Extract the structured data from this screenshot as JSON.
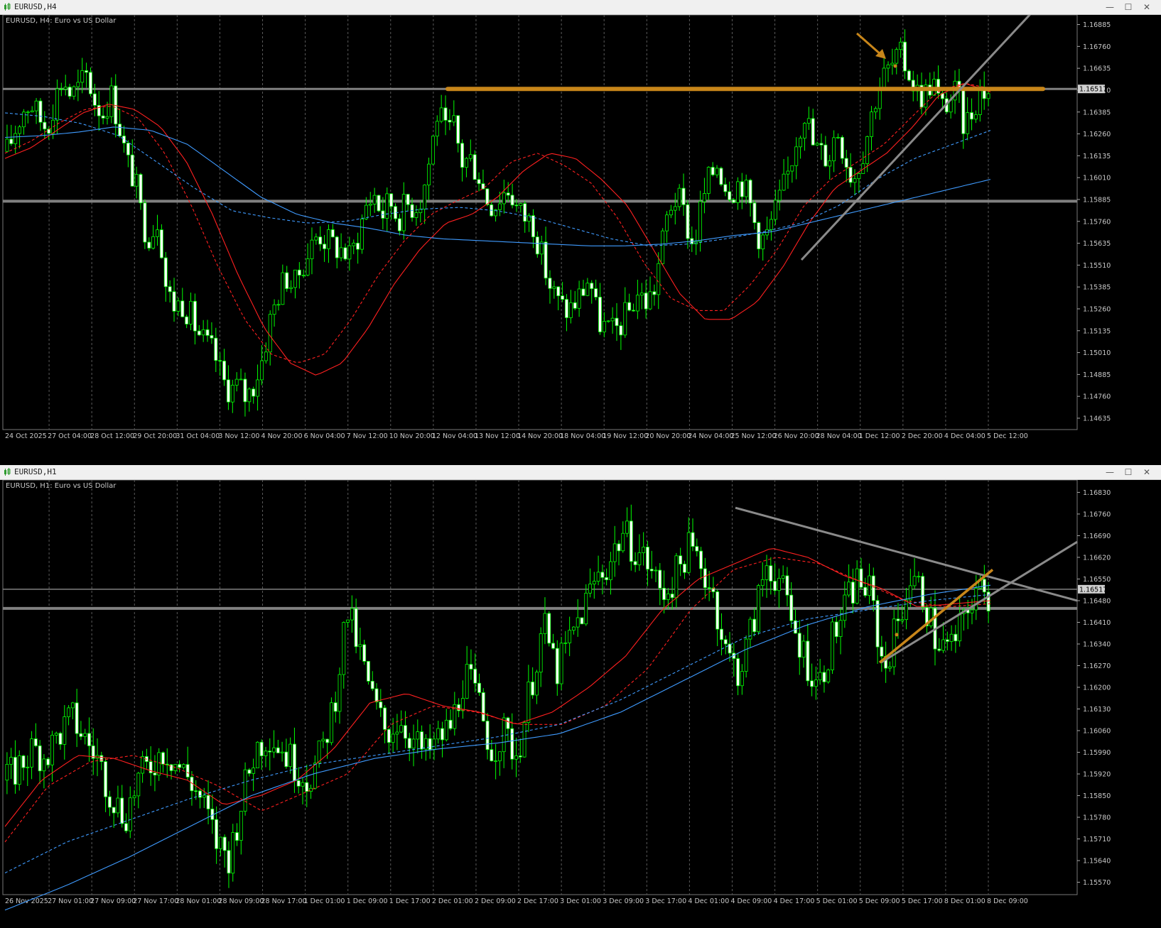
{
  "windows": [
    {
      "title": "EURUSD,H4",
      "label": "EURUSD, H4:  Euro vs US Dollar",
      "price_tag": "1.16517",
      "controls": [
        "—",
        "☐",
        "✕"
      ]
    },
    {
      "title": "EURUSD,H1",
      "label": "EURUSD, H1:  Euro vs US Dollar",
      "price_tag": "1.16517",
      "controls": [
        "—",
        "☐",
        "✕"
      ]
    }
  ],
  "colors": {
    "bull": "#00ff00",
    "bear": "#ffffff",
    "fast_ma": "#ff2020",
    "slow_ma": "#3f9bff",
    "level": "#808080",
    "annotation": "#c8861a",
    "grid": "#5a5a5a",
    "axis_text": "#c8c8c8"
  },
  "chart_data": [
    {
      "type": "candlestick",
      "symbol": "EURUSD",
      "timeframe": "H4",
      "ylim": [
        1.1457,
        1.1694
      ],
      "yticks": [
        "1.16885",
        "1.16760",
        "1.16635",
        "1.16510",
        "1.16385",
        "1.16260",
        "1.16135",
        "1.16010",
        "1.15885",
        "1.15760",
        "1.15635",
        "1.15510",
        "1.15385",
        "1.15260",
        "1.15135",
        "1.15010",
        "1.14885",
        "1.14760",
        "1.14635"
      ],
      "xticks": [
        "24 Oct 2025",
        "27 Oct 04:00",
        "28 Oct 12:00",
        "29 Oct 20:00",
        "31 Oct 04:00",
        "3 Nov 12:00",
        "4 Nov 20:00",
        "6 Nov 04:00",
        "7 Nov 12:00",
        "10 Nov 20:00",
        "12 Nov 04:00",
        "13 Nov 12:00",
        "14 Nov 20:00",
        "18 Nov 04:00",
        "19 Nov 12:00",
        "20 Nov 20:00",
        "24 Nov 04:00",
        "25 Nov 12:00",
        "26 Nov 20:00",
        "28 Nov 04:00",
        "1 Dec 12:00",
        "2 Dec 20:00",
        "4 Dec 04:00",
        "5 Dec 12:00"
      ],
      "candle_count": 236,
      "close_path": [
        1.1616,
        1.1628,
        1.164,
        1.1644,
        1.1635,
        1.163,
        1.1646,
        1.1658,
        1.1648,
        1.1652,
        1.166,
        1.1645,
        1.1638,
        1.1649,
        1.1633,
        1.161,
        1.16,
        1.1575,
        1.1568,
        1.158,
        1.1535,
        1.1528,
        1.153,
        1.1522,
        1.1512,
        1.1505,
        1.15,
        1.1485,
        1.148,
        1.1482,
        1.1475,
        1.1484,
        1.1498,
        1.152,
        1.1535,
        1.1545,
        1.1538,
        1.1552,
        1.156,
        1.157,
        1.1565,
        1.1562,
        1.156,
        1.1555,
        1.1568,
        1.1585,
        1.1592,
        1.158,
        1.1588,
        1.1578,
        1.1586,
        1.1585,
        1.159,
        1.1613,
        1.164,
        1.1625,
        1.163,
        1.161,
        1.1612,
        1.1605,
        1.159,
        1.1585,
        1.1592,
        1.1595,
        1.1582,
        1.1578,
        1.1575,
        1.1556,
        1.154,
        1.153,
        1.1525,
        1.1528,
        1.1535,
        1.1545,
        1.152,
        1.1515,
        1.1512,
        1.1518,
        1.1525,
        1.1535,
        1.153,
        1.1535,
        1.156,
        1.1585,
        1.159,
        1.1578,
        1.156,
        1.1585,
        1.16,
        1.161,
        1.1598,
        1.1595,
        1.16,
        1.1588,
        1.157,
        1.1565,
        1.1578,
        1.159,
        1.1605,
        1.1625,
        1.164,
        1.162,
        1.1615,
        1.1613,
        1.163,
        1.1615,
        1.16,
        1.1612,
        1.163,
        1.165,
        1.166,
        1.1665,
        1.167,
        1.1662,
        1.165,
        1.1648,
        1.1658,
        1.164,
        1.1645,
        1.165,
        1.163,
        1.164,
        1.1652,
        1.165
      ],
      "indicators": [
        {
          "name": "MA fast",
          "style": "solid",
          "color": "#ff2020",
          "path": [
            1.1612,
            1.1618,
            1.1628,
            1.1638,
            1.1643,
            1.164,
            1.163,
            1.161,
            1.158,
            1.1545,
            1.1515,
            1.1495,
            1.1488,
            1.1495,
            1.1515,
            1.154,
            1.156,
            1.1575,
            1.158,
            1.159,
            1.1605,
            1.1615,
            1.1612,
            1.16,
            1.1585,
            1.156,
            1.1535,
            1.152,
            1.152,
            1.153,
            1.155,
            1.1575,
            1.1595,
            1.1605,
            1.1615,
            1.163,
            1.1648,
            1.1655,
            1.165
          ]
        },
        {
          "name": "MA fast signal",
          "style": "dashed",
          "color": "#ff2020",
          "path": [
            1.1615,
            1.1622,
            1.1632,
            1.164,
            1.1642,
            1.1635,
            1.1615,
            1.1585,
            1.155,
            1.152,
            1.15,
            1.1495,
            1.15,
            1.152,
            1.1545,
            1.1565,
            1.158,
            1.1588,
            1.1595,
            1.161,
            1.1615,
            1.1608,
            1.1598,
            1.1578,
            1.1552,
            1.1532,
            1.1525,
            1.1525,
            1.154,
            1.156,
            1.1585,
            1.16,
            1.161,
            1.162,
            1.1635,
            1.165,
            1.1655,
            1.1652
          ]
        },
        {
          "name": "MA slow",
          "style": "solid",
          "color": "#3f9bff",
          "path": [
            1.1624,
            1.1625,
            1.1627,
            1.163,
            1.1628,
            1.162,
            1.1605,
            1.159,
            1.158,
            1.1575,
            1.1572,
            1.1568,
            1.1566,
            1.1565,
            1.1564,
            1.1563,
            1.1562,
            1.1562,
            1.1563,
            1.1565,
            1.1568,
            1.157,
            1.1575,
            1.158,
            1.1585,
            1.159,
            1.1595,
            1.16
          ]
        },
        {
          "name": "MA slow signal",
          "style": "dashed",
          "color": "#3f9bff",
          "path": [
            1.1638,
            1.1636,
            1.1632,
            1.1625,
            1.161,
            1.1595,
            1.1582,
            1.1578,
            1.1575,
            1.1576,
            1.158,
            1.1583,
            1.1584,
            1.1582,
            1.1578,
            1.1572,
            1.1566,
            1.1562,
            1.1563,
            1.1566,
            1.157,
            1.1575,
            1.1585,
            1.16,
            1.1612,
            1.162,
            1.1628
          ]
        }
      ],
      "levels": [
        1.16517,
        1.15875
      ],
      "annotated_level": 1.16517,
      "trendline": [
        [
          1.1554,
          1.1704
        ]
      ],
      "current_price": "1.16517"
    },
    {
      "type": "candlestick",
      "symbol": "EURUSD",
      "timeframe": "H1",
      "ylim": [
        1.1553,
        1.1687
      ],
      "yticks": [
        "1.16830",
        "1.16760",
        "1.16690",
        "1.16620",
        "1.16550",
        "1.16480",
        "1.16410",
        "1.16340",
        "1.16270",
        "1.16200",
        "1.16130",
        "1.16060",
        "1.15990",
        "1.15920",
        "1.15850",
        "1.15780",
        "1.15710",
        "1.15640",
        "1.15570"
      ],
      "xticks": [
        "26 Nov 2025",
        "27 Nov 01:00",
        "27 Nov 09:00",
        "27 Nov 17:00",
        "28 Nov 01:00",
        "28 Nov 09:00",
        "28 Nov 17:00",
        "1 Dec 01:00",
        "1 Dec 09:00",
        "1 Dec 17:00",
        "2 Dec 01:00",
        "2 Dec 09:00",
        "2 Dec 17:00",
        "3 Dec 01:00",
        "3 Dec 09:00",
        "3 Dec 17:00",
        "4 Dec 01:00",
        "4 Dec 09:00",
        "4 Dec 17:00",
        "5 Dec 01:00",
        "5 Dec 09:00",
        "5 Dec 17:00",
        "8 Dec 01:00",
        "8 Dec 09:00"
      ],
      "candle_count": 240,
      "close_path": [
        1.159,
        1.1595,
        1.16,
        1.1598,
        1.1605,
        1.161,
        1.1603,
        1.1596,
        1.1585,
        1.1578,
        1.159,
        1.1595,
        1.16,
        1.1595,
        1.159,
        1.1582,
        1.157,
        1.1565,
        1.1585,
        1.16,
        1.1605,
        1.16,
        1.1595,
        1.159,
        1.1598,
        1.1615,
        1.1645,
        1.163,
        1.1615,
        1.1605,
        1.161,
        1.1603,
        1.1598,
        1.1603,
        1.1608,
        1.1625,
        1.1615,
        1.16,
        1.1605,
        1.1598,
        1.162,
        1.164,
        1.1625,
        1.1635,
        1.1645,
        1.1655,
        1.166,
        1.167,
        1.1665,
        1.166,
        1.165,
        1.1655,
        1.1665,
        1.166,
        1.165,
        1.163,
        1.1625,
        1.164,
        1.166,
        1.1655,
        1.164,
        1.163,
        1.162,
        1.1635,
        1.1645,
        1.1655,
        1.165,
        1.1625,
        1.164,
        1.1655,
        1.165,
        1.1635,
        1.1632,
        1.164,
        1.1652,
        1.1648
      ],
      "indicators": [
        {
          "name": "MA fast",
          "style": "solid",
          "color": "#ff2020",
          "path": [
            1.1575,
            1.159,
            1.1598,
            1.1597,
            1.1593,
            1.159,
            1.1582,
            1.1585,
            1.159,
            1.16,
            1.1615,
            1.1618,
            1.1614,
            1.1612,
            1.1608,
            1.1612,
            1.162,
            1.163,
            1.1645,
            1.1655,
            1.166,
            1.1665,
            1.1662,
            1.1656,
            1.1652,
            1.1646,
            1.1647,
            1.1648
          ]
        },
        {
          "name": "MA fast signal",
          "style": "dashed",
          "color": "#ff2020",
          "path": [
            1.157,
            1.1588,
            1.1596,
            1.1598,
            1.1594,
            1.1588,
            1.158,
            1.1586,
            1.1592,
            1.1608,
            1.1614,
            1.1612,
            1.1608,
            1.1608,
            1.1614,
            1.1626,
            1.1645,
            1.1658,
            1.1662,
            1.166,
            1.1654,
            1.1648,
            1.1646,
            1.1647
          ]
        },
        {
          "name": "MA slow",
          "style": "solid",
          "color": "#3f9bff",
          "path": [
            1.1548,
            1.1556,
            1.1565,
            1.1575,
            1.1585,
            1.1592,
            1.1597,
            1.16,
            1.1602,
            1.1605,
            1.1612,
            1.1622,
            1.1632,
            1.164,
            1.1646,
            1.165,
            1.1653
          ]
        },
        {
          "name": "MA slow signal",
          "style": "dashed",
          "color": "#3f9bff",
          "path": [
            1.156,
            1.157,
            1.1577,
            1.1584,
            1.159,
            1.1595,
            1.1598,
            1.1601,
            1.1604,
            1.1608,
            1.1616,
            1.1626,
            1.1636,
            1.1642,
            1.1645,
            1.1648,
            1.165
          ]
        }
      ],
      "levels": [
        1.16517,
        1.16455
      ],
      "trendlines": [
        {
          "color": "gray",
          "from": [
            1.1678
          ],
          "to": [
            1.1648
          ]
        },
        {
          "color": "gray",
          "from": [
            1.1628
          ],
          "to": [
            1.1667
          ]
        },
        {
          "color": "orange",
          "from": [
            1.1628
          ],
          "to": [
            1.1658
          ]
        }
      ],
      "current_price": "1.16517"
    }
  ]
}
